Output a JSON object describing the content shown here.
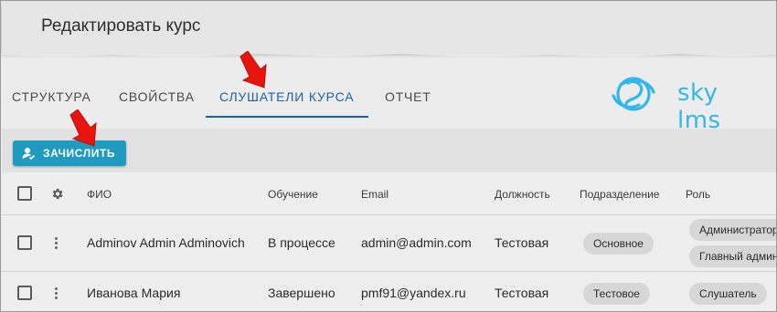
{
  "page": {
    "title": "Редактировать курс"
  },
  "tabs": [
    {
      "label": "Структура",
      "active": false
    },
    {
      "label": "Свойства",
      "active": false
    },
    {
      "label": "Слушатели курса",
      "active": true
    },
    {
      "label": "Отчет",
      "active": false
    }
  ],
  "logo": {
    "text": "sky lms",
    "color": "#33b7e8"
  },
  "toolbar": {
    "enroll_label": "ЗАЧИСЛИТЬ",
    "enroll_icon": "person-add-icon",
    "button_color": "#1f9bc0"
  },
  "table": {
    "headers": {
      "settings_icon": "gear-icon",
      "name": "ФИО",
      "status": "Обучение",
      "email": "Email",
      "position": "Должность",
      "department": "Подразделение",
      "role": "Роль"
    },
    "rows": [
      {
        "name": "Adminov Admin Adminovich",
        "status": "В процессе",
        "email": "admin@admin.com",
        "position": "Тестовая",
        "department": "Основное",
        "roles": [
          "Администратор",
          "Главный админ"
        ]
      },
      {
        "name": "Иванова Мария",
        "status": "Завершено",
        "email": "pmf91@yandex.ru",
        "position": "Тестовая",
        "department": "Тестовое",
        "roles": [
          "Слушатель"
        ]
      }
    ]
  },
  "annotations": {
    "arrow_color": "#e8150f"
  }
}
